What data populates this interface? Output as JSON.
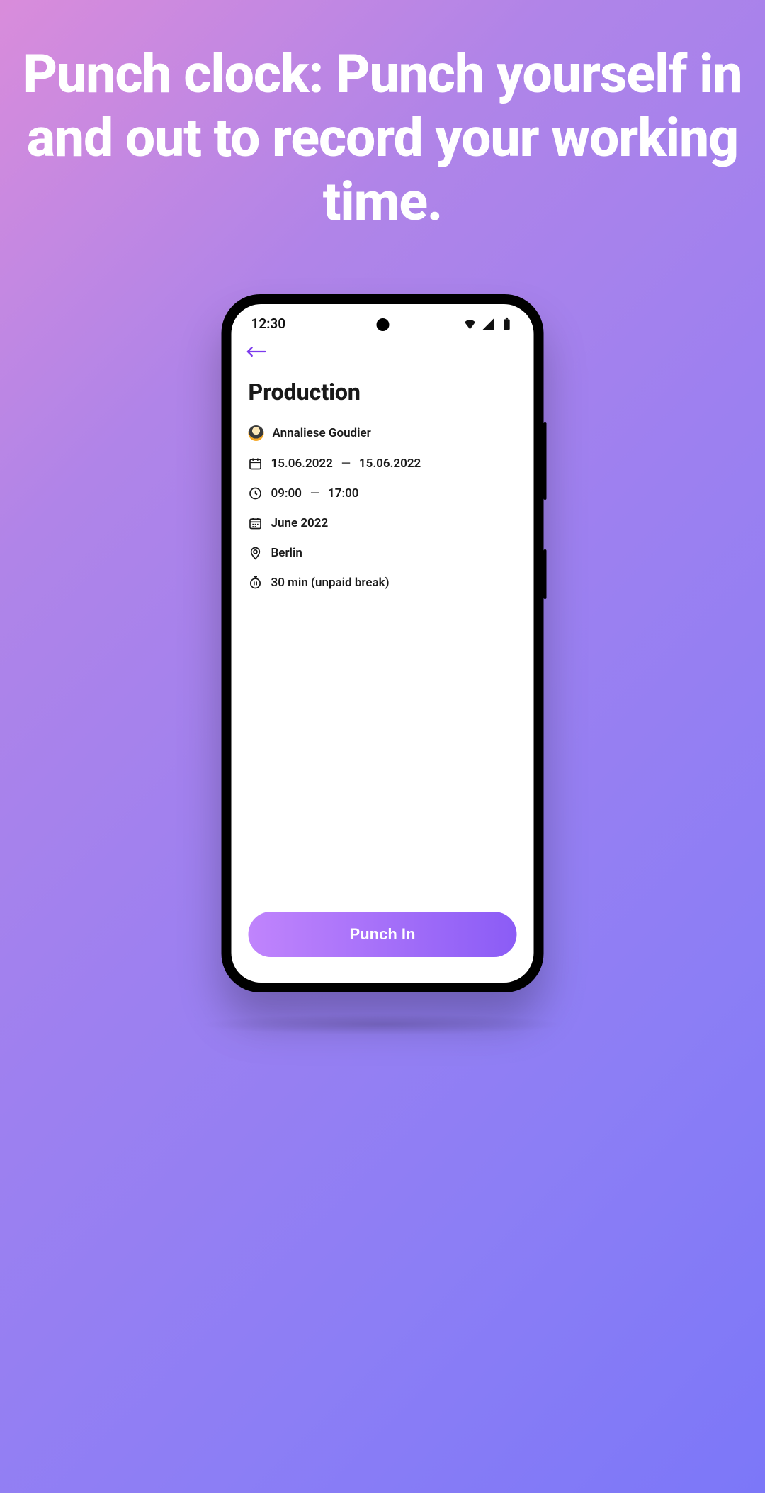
{
  "marketing": {
    "heading": "Punch clock: Punch yourself in and out to record your working time."
  },
  "status": {
    "time": "12:30"
  },
  "page": {
    "title": "Production",
    "user_name": "Annaliese Goudier",
    "date_start": "15.06.2022",
    "date_end": "15.06.2022",
    "time_start": "09:00",
    "time_end": "17:00",
    "month": "June 2022",
    "location": "Berlin",
    "break_text": "30 min (unpaid break)",
    "separator": "—"
  },
  "actions": {
    "punch_in_label": "Punch In"
  },
  "icons": {
    "back": "back-arrow-icon",
    "avatar": "user-avatar",
    "calendar": "calendar-icon",
    "clock": "clock-icon",
    "month": "calendar-month-icon",
    "location": "location-pin-icon",
    "break": "pause-timer-icon",
    "wifi": "wifi-icon",
    "signal": "signal-icon",
    "battery": "battery-icon"
  }
}
